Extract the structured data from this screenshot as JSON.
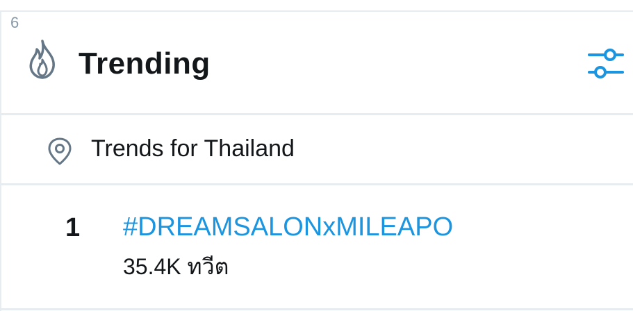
{
  "corner_number": "6",
  "header": {
    "title": "Trending",
    "icon": "flame-icon",
    "settings_icon": "sliders-icon",
    "accent_color": "#1b95e0"
  },
  "location": {
    "icon": "map-pin-icon",
    "label": "Trends for Thailand"
  },
  "trends": [
    {
      "rank": "1",
      "hashtag": "#DREAMSALONxMILEAPO",
      "tweet_count": "35.4K ทวีต"
    }
  ]
}
